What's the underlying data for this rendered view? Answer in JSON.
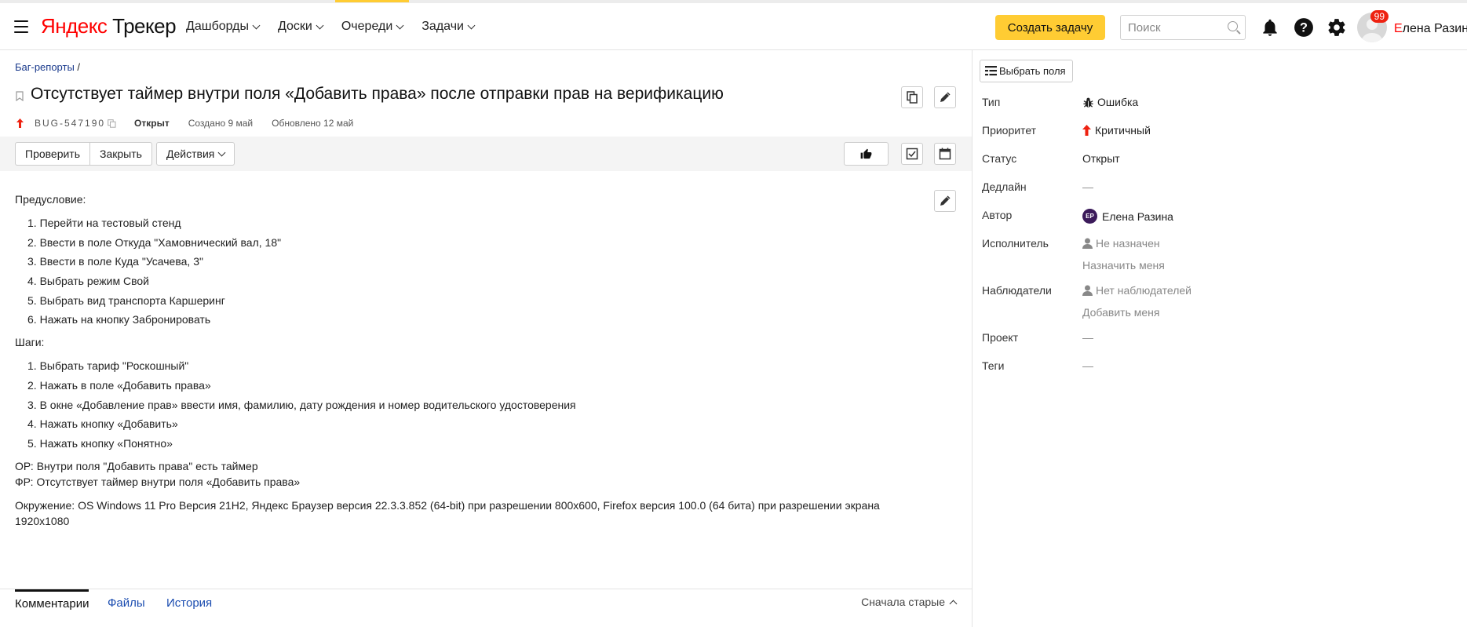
{
  "header": {
    "logo_ya": "Яндекс",
    "logo_product": " Трекер",
    "nav": [
      {
        "label": "Дашборды",
        "active": false
      },
      {
        "label": "Доски",
        "active": false
      },
      {
        "label": "Очереди",
        "active": true
      },
      {
        "label": "Задачи",
        "active": false
      }
    ],
    "create_button": "Создать задачу",
    "search_placeholder": "Поиск",
    "notifications_count": "99",
    "user_initial": "Е",
    "user_rest": "лена Разина"
  },
  "issue": {
    "breadcrumb_link": "Баг-репорты",
    "breadcrumb_sep": " /",
    "title": "Отсутствует таймер внутри поля «Добавить права» после отправки прав на верификацию",
    "key": "BUG-547190",
    "status": "Открыт",
    "created": "Создано 9 май",
    "updated": "Обновлено 12 май",
    "priority_color": "#e21"
  },
  "toolbar": {
    "check_button": "Проверить",
    "close_button": "Закрыть",
    "actions_button": "Действия"
  },
  "description": {
    "precondition_heading": "Предусловие:",
    "precondition_steps": [
      "1. Перейти на тестовый стенд",
      "2. Ввести в поле Откуда \"Хамовнический вал, 18\"",
      "3. Ввести в поле Куда \"Усачева, 3\"",
      "4. Выбрать режим Свой",
      "5. Выбрать вид транспорта Каршеринг",
      "6. Нажать на кнопку Забронировать"
    ],
    "steps_heading": "Шаги:",
    "steps": [
      "1. Выбрать тариф \"Роскошный\"",
      "2. Нажать в поле «Добавить права»",
      "3. В окне «Добавление прав» ввести имя, фамилию, дату рождения и номер водительского удостоверения",
      "4. Нажать кнопку «Добавить»",
      "5. Нажать кнопку «Понятно»"
    ],
    "expected": "ОР: Внутри поля \"Добавить права\" есть таймер",
    "actual": "ФР: Отсутствует таймер внутри поля «Добавить права»",
    "environment": "Окружение: OS Windows 11 Pro Версия 21H2, Яндекс Браузер версия 22.3.3.852 (64-bit) при разрешении 800x600, Firefox версия 100.0 (64 бита) при разрешении экрана 1920x1080"
  },
  "tabs": {
    "comments": "Комментарии",
    "files": "Файлы",
    "history": "История",
    "sort": "Сначала старые"
  },
  "sidebar": {
    "choose_fields": "Выбрать поля",
    "fields": {
      "type_label": "Тип",
      "type_value": "Ошибка",
      "priority_label": "Приоритет",
      "priority_value": "Критичный",
      "status_label": "Статус",
      "status_value": "Открыт",
      "deadline_label": "Дедлайн",
      "deadline_value": "—",
      "author_label": "Автор",
      "author_initials": "ЕР",
      "author_value": "Елена Разина",
      "assignee_label": "Исполнитель",
      "assignee_value": "Не назначен",
      "assign_me": "Назначить меня",
      "watchers_label": "Наблюдатели",
      "watchers_value": "Нет наблюдателей",
      "add_me": "Добавить меня",
      "project_label": "Проект",
      "project_value": "—",
      "tags_label": "Теги",
      "tags_value": "—"
    }
  },
  "colors": {
    "accent_yellow": "#ffcc33",
    "link_blue": "#1a4cb0",
    "critical_red": "#ee2211"
  }
}
